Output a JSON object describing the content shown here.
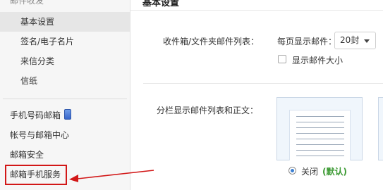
{
  "sidebar": {
    "cut_title": "邮件收发",
    "items": [
      {
        "label": "基本设置",
        "active": true
      },
      {
        "label": "签名/电子名片",
        "active": false
      },
      {
        "label": "来信分类",
        "active": false
      },
      {
        "label": "信纸",
        "active": false
      }
    ],
    "items2": [
      {
        "label": "手机号码邮箱"
      },
      {
        "label": "帐号与邮箱中心"
      },
      {
        "label": "邮箱安全"
      },
      {
        "label": "邮箱手机服务"
      }
    ]
  },
  "main": {
    "title": "基本设置",
    "list_label": "收件箱/文件夹邮件列表：",
    "per_page_label": "每页显示邮件：",
    "per_page_value": "20封",
    "show_size_label": "显示邮件大小",
    "split_label": "分栏显示邮件列表和正文：",
    "radio_label": "关闭",
    "default_tag": "(默认)"
  },
  "colors": {
    "highlight": "#d21717",
    "default_green": "#3c9a33",
    "sidebar_bg": "#f6f6f6"
  }
}
